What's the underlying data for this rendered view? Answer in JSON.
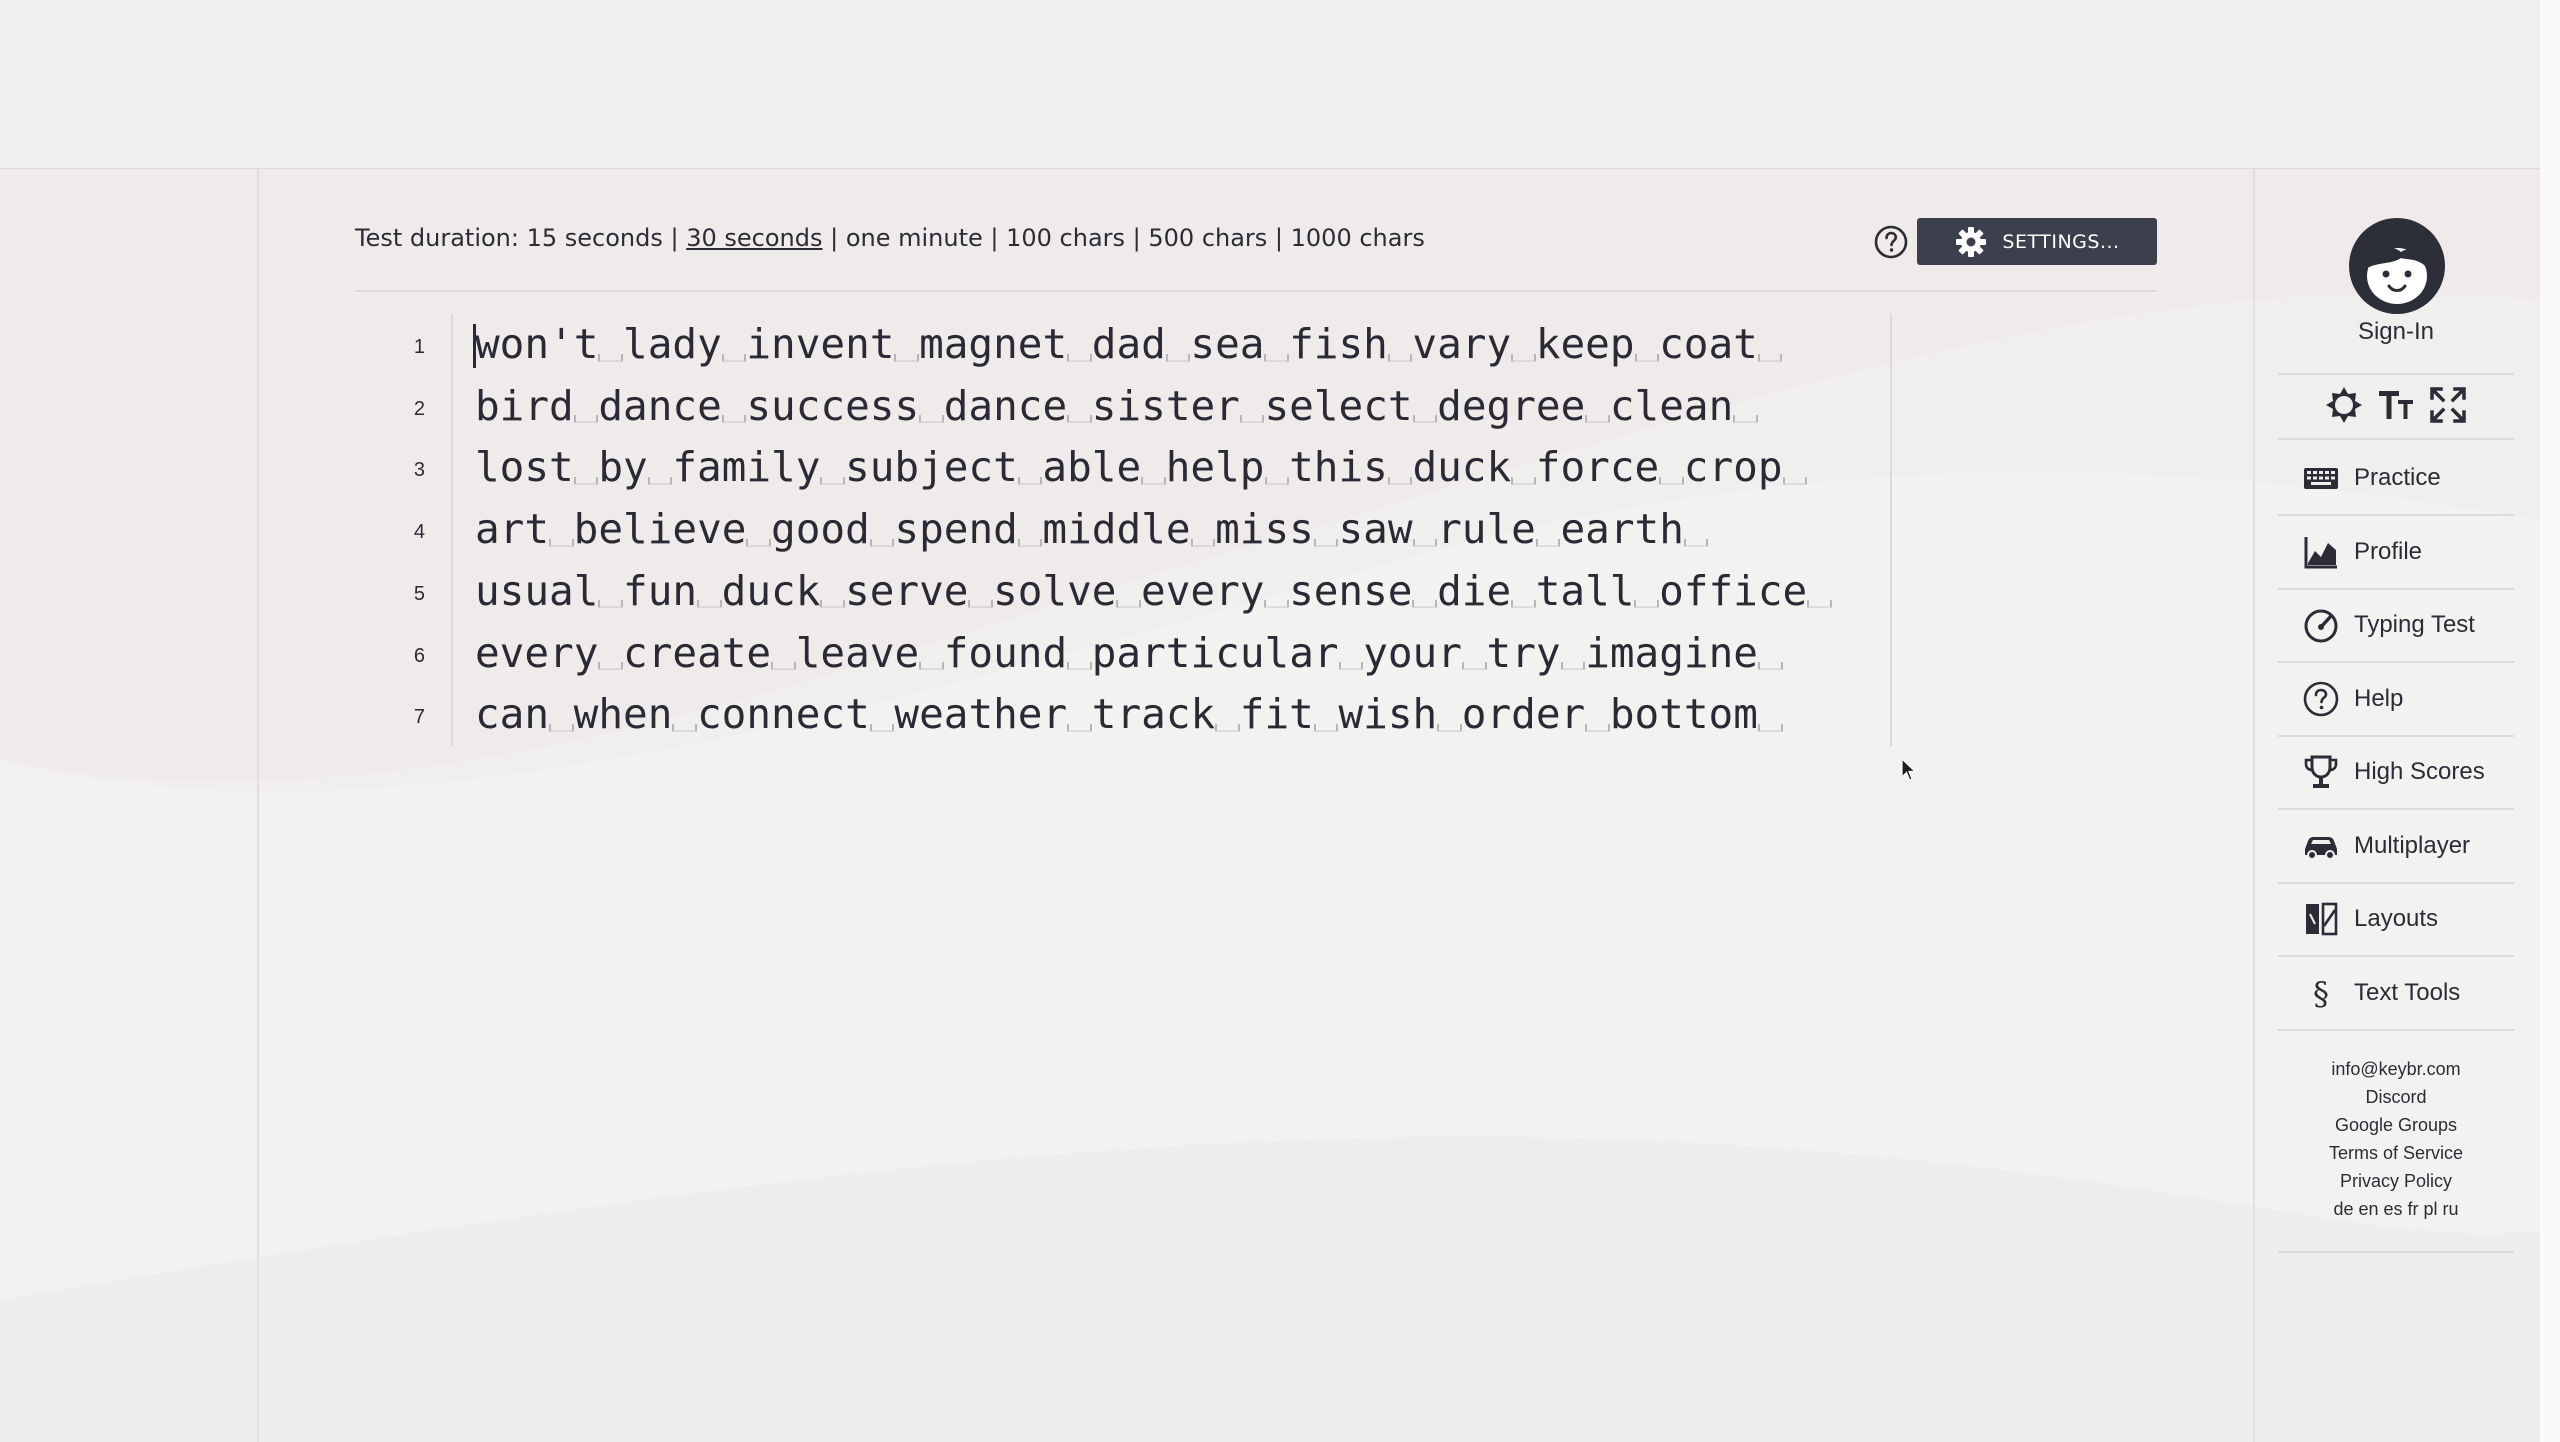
{
  "test_duration": {
    "prefix": "Test duration: ",
    "options": [
      "15 seconds",
      "30 seconds",
      "one minute",
      "100 chars",
      "500 chars",
      "1000 chars"
    ],
    "separator": " | ",
    "selected": "30 seconds"
  },
  "settings_button": {
    "label": "SETTINGS..."
  },
  "editor": {
    "lines": [
      {
        "num": "1",
        "words": [
          "won't",
          "lady",
          "invent",
          "magnet",
          "dad",
          "sea",
          "fish",
          "vary",
          "keep",
          "coat"
        ]
      },
      {
        "num": "2",
        "words": [
          "bird",
          "dance",
          "success",
          "dance",
          "sister",
          "select",
          "degree",
          "clean"
        ]
      },
      {
        "num": "3",
        "words": [
          "lost",
          "by",
          "family",
          "subject",
          "able",
          "help",
          "this",
          "duck",
          "force",
          "crop"
        ]
      },
      {
        "num": "4",
        "words": [
          "art",
          "believe",
          "good",
          "spend",
          "middle",
          "miss",
          "saw",
          "rule",
          "earth"
        ]
      },
      {
        "num": "5",
        "words": [
          "usual",
          "fun",
          "duck",
          "serve",
          "solve",
          "every",
          "sense",
          "die",
          "tall",
          "office"
        ]
      },
      {
        "num": "6",
        "words": [
          "every",
          "create",
          "leave",
          "found",
          "particular",
          "your",
          "try",
          "imagine"
        ]
      },
      {
        "num": "7",
        "words": [
          "can",
          "when",
          "connect",
          "weather",
          "track",
          "fit",
          "wish",
          "order",
          "bottom"
        ]
      }
    ]
  },
  "sidebar": {
    "signin": "Sign-In",
    "tools": [
      "theme-icon",
      "font-size-icon",
      "fullscreen-icon"
    ],
    "nav": [
      {
        "label": "Practice",
        "icon": "keyboard-icon"
      },
      {
        "label": "Profile",
        "icon": "chart-icon"
      },
      {
        "label": "Typing Test",
        "icon": "speedometer-icon"
      },
      {
        "label": "Help",
        "icon": "help-icon"
      },
      {
        "label": "High Scores",
        "icon": "trophy-icon"
      },
      {
        "label": "Multiplayer",
        "icon": "car-icon"
      },
      {
        "label": "Layouts",
        "icon": "layouts-icon"
      },
      {
        "label": "Text Tools",
        "icon": "section-icon"
      }
    ],
    "links": [
      "info@keybr.com",
      "Discord",
      "Google Groups",
      "Terms of Service",
      "Privacy Policy",
      "de en es fr pl ru"
    ]
  }
}
